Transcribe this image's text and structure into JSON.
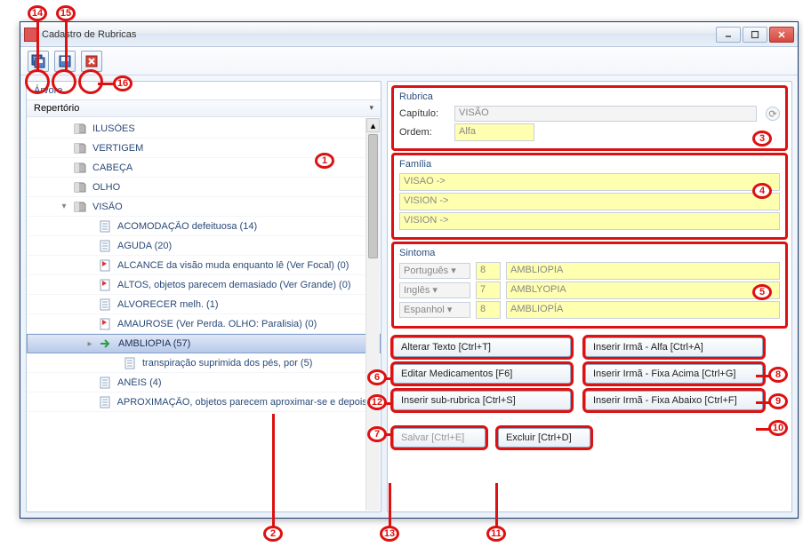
{
  "window": {
    "title": "Cadastro de Rubricas"
  },
  "toolbar": {
    "save_all": "Save All",
    "save": "Save",
    "close": "Close"
  },
  "left": {
    "header": "Árvore",
    "column": "Repertório",
    "items": [
      {
        "label": "ILUSÕES",
        "depth": 1,
        "icon": "book"
      },
      {
        "label": "VERTIGEM",
        "depth": 1,
        "icon": "book"
      },
      {
        "label": "CABEÇA",
        "depth": 1,
        "icon": "book"
      },
      {
        "label": "OLHO",
        "depth": 1,
        "icon": "book"
      },
      {
        "label": "VISÃO",
        "depth": 1,
        "icon": "book",
        "expander": "▾"
      },
      {
        "label": "ACOMODAÇÃO defeituosa (14)",
        "depth": 2,
        "icon": "page"
      },
      {
        "label": "AGUDA (20)",
        "depth": 2,
        "icon": "page"
      },
      {
        "label": "ALCANCE da visão muda enquanto lê (Ver Focal) (0)",
        "depth": 2,
        "icon": "flag"
      },
      {
        "label": "ALTOS, objetos parecem demasiado (Ver Grande) (0)",
        "depth": 2,
        "icon": "flag"
      },
      {
        "label": "ALVORECER melh. (1)",
        "depth": 2,
        "icon": "page"
      },
      {
        "label": "AMAUROSE (Ver Perda. OLHO: Paralisia) (0)",
        "depth": 2,
        "icon": "flag"
      },
      {
        "label": "AMBLIOPIA (57)",
        "depth": 2,
        "icon": "arrow",
        "expander": "▸",
        "selected": true
      },
      {
        "label": "transpiração suprimida dos pés, por (5)",
        "depth": 3,
        "icon": "page"
      },
      {
        "label": "ANÉIS (4)",
        "depth": 2,
        "icon": "page"
      },
      {
        "label": "APROXIMAÇÃO, objetos parecem aproximar-se e depois rec...",
        "depth": 2,
        "icon": "page"
      }
    ]
  },
  "rubrica": {
    "title": "Rubrica",
    "capitulo_label": "Capítulo:",
    "capitulo_value": "VISÃO",
    "ordem_label": "Ordem:",
    "ordem_value": "Alfa"
  },
  "familia": {
    "title": "Família",
    "rows": [
      "VISAO ->",
      "VISION ->",
      "VISION ->"
    ]
  },
  "sintoma": {
    "title": "Sintoma",
    "rows": [
      {
        "lang": "Português",
        "num": "8",
        "text": "AMBLIOPIA"
      },
      {
        "lang": "Inglês",
        "num": "7",
        "text": "AMBLYOPIA"
      },
      {
        "lang": "Espanhol",
        "num": "8",
        "text": "AMBLIOPÍA"
      }
    ]
  },
  "buttons": {
    "alterar": "Alterar Texto [Ctrl+T]",
    "editar": "Editar Medicamentos [F6]",
    "inserir_sub": "Inserir sub-rubrica [Ctrl+S]",
    "irma_alfa": "Inserir Irmã - Alfa [Ctrl+A]",
    "irma_acima": "Inserir Irmã - Fixa Acima [Ctrl+G]",
    "irma_abaixo": "Inserir Irmã - Fixa Abaixo [Ctrl+F]",
    "salvar": "Salvar [Ctrl+E]",
    "excluir": "Excluir [Ctrl+D]"
  },
  "callouts": {
    "1": "1",
    "2": "2",
    "3": "3",
    "4": "4",
    "5": "5",
    "6": "6",
    "7": "7",
    "8": "8",
    "9": "9",
    "10": "10",
    "11": "11",
    "12": "12",
    "13": "13",
    "14": "14",
    "15": "15",
    "16": "16"
  }
}
